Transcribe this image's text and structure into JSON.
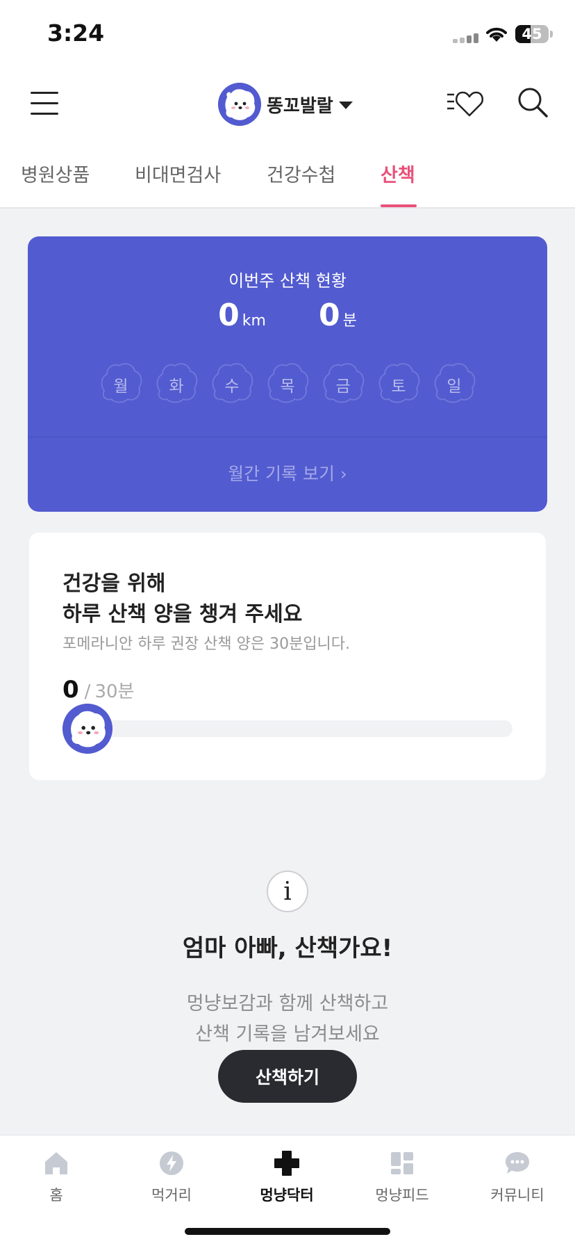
{
  "status_bar": {
    "time": "3:24",
    "battery": "45",
    "battery_level": 0.45
  },
  "header": {
    "pet_name": "똥꼬발랄",
    "icons": [
      "menu-icon",
      "avatar",
      "caret-down-icon",
      "heart-list-icon",
      "search-icon"
    ]
  },
  "tabs": [
    {
      "label": "병원상품",
      "active": false
    },
    {
      "label": "비대면검사",
      "active": false
    },
    {
      "label": "건강수첩",
      "active": false
    },
    {
      "label": "산책",
      "active": true
    }
  ],
  "weekly": {
    "title": "이번주 산책 현황",
    "distance_value": "0",
    "distance_unit": "km",
    "time_value": "0",
    "time_unit": "분",
    "days": [
      "월",
      "화",
      "수",
      "목",
      "금",
      "토",
      "일"
    ],
    "monthly_link": "월간 기록 보기 ›"
  },
  "goal": {
    "line1": "건강을 위해",
    "line2": "하루 산책 양을 챙겨 주세요",
    "subtitle": "포메라니안 하루 권장 산책 양은 30분입니다.",
    "current": "0",
    "separator": "/",
    "target": "30분",
    "progress": 0
  },
  "empty_state": {
    "icon": "i",
    "title": "엄마 아빠, 산책가요!",
    "line1": "멍냥보감과 함께 산책하고",
    "line2": "산책 기록을 남겨보세요",
    "button": "산책하기"
  },
  "bottom_nav": [
    {
      "label": "홈",
      "icon": "home-icon",
      "active": false
    },
    {
      "label": "먹거리",
      "icon": "bolt-icon",
      "active": false
    },
    {
      "label": "멍냥닥터",
      "icon": "medical-cross-icon",
      "active": true
    },
    {
      "label": "멍냥피드",
      "icon": "feed-icon",
      "active": false
    },
    {
      "label": "커뮤니티",
      "icon": "chat-icon",
      "active": false
    }
  ],
  "colors": {
    "accent": "#e9507a",
    "brand": "#525bcf",
    "dark": "#2a2b30"
  }
}
